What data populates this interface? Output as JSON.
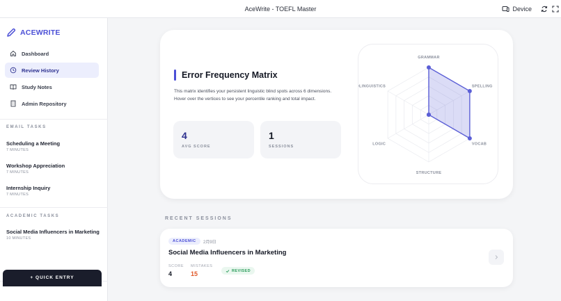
{
  "window": {
    "title": "AceWrite - TOEFL Master",
    "device_label": "Device",
    "icons": [
      "device-icon",
      "sync-icon",
      "fullscreen-icon"
    ]
  },
  "sidebar": {
    "brand": "ACEWRITE",
    "brand_icon": "pencil-icon",
    "nav": [
      {
        "label": "Dashboard",
        "icon": "home-icon",
        "active": false
      },
      {
        "label": "Review History",
        "icon": "clock-icon",
        "active": true
      },
      {
        "label": "Study Notes",
        "icon": "book-icon",
        "active": false
      },
      {
        "label": "Admin Repository",
        "icon": "building-icon",
        "active": false
      }
    ],
    "email_tasks": {
      "label": "EMAIL TASKS",
      "items": [
        {
          "title": "Scheduling a Meeting",
          "meta": "7 MINUTES"
        },
        {
          "title": "Workshop Appreciation",
          "meta": "7 MINUTES"
        },
        {
          "title": "Internship Inquiry",
          "meta": "7 MINUTES"
        }
      ]
    },
    "academic_tasks": {
      "label": "ACADEMIC TASKS",
      "items": [
        {
          "title": "Social Media Influencers in Marketing",
          "meta": "10 MINUTES"
        }
      ]
    },
    "quick_entry": "+ QUICK ENTRY"
  },
  "matrix": {
    "title": "Error Frequency Matrix",
    "description": "This matrix identifies your persistent linguistic blind spots across 6 dimensions. Hover over the vertices to see your percentile ranking and total impact.",
    "stats": [
      {
        "value": "4",
        "label": "AVG SCORE",
        "color": "#2d318f"
      },
      {
        "value": "1",
        "label": "SESSIONS",
        "color": "#141824"
      }
    ],
    "radar": {
      "axes": [
        "GRAMMAR",
        "SPELLING",
        "VOCAB",
        "STRUCTURE",
        "LOGIC",
        "SOCIOLINGUISTICS"
      ],
      "values": [
        1.0,
        1.0,
        1.0,
        0.0,
        0.0,
        0.0
      ],
      "max": 1.0,
      "accent": "#5b5fd6"
    }
  },
  "recent": {
    "label": "RECENT SESSIONS",
    "sessions": [
      {
        "badge": "ACADEMIC",
        "date": "2月9日",
        "title": "Social Media Influencers in Marketing",
        "score_label": "SCORE",
        "score": "4",
        "mistakes_label": "MISTAKES",
        "mistakes": "15",
        "status": "REVISED",
        "mistakes_color": "#e05a2b",
        "status_color": "#2a9c5a"
      }
    ]
  }
}
